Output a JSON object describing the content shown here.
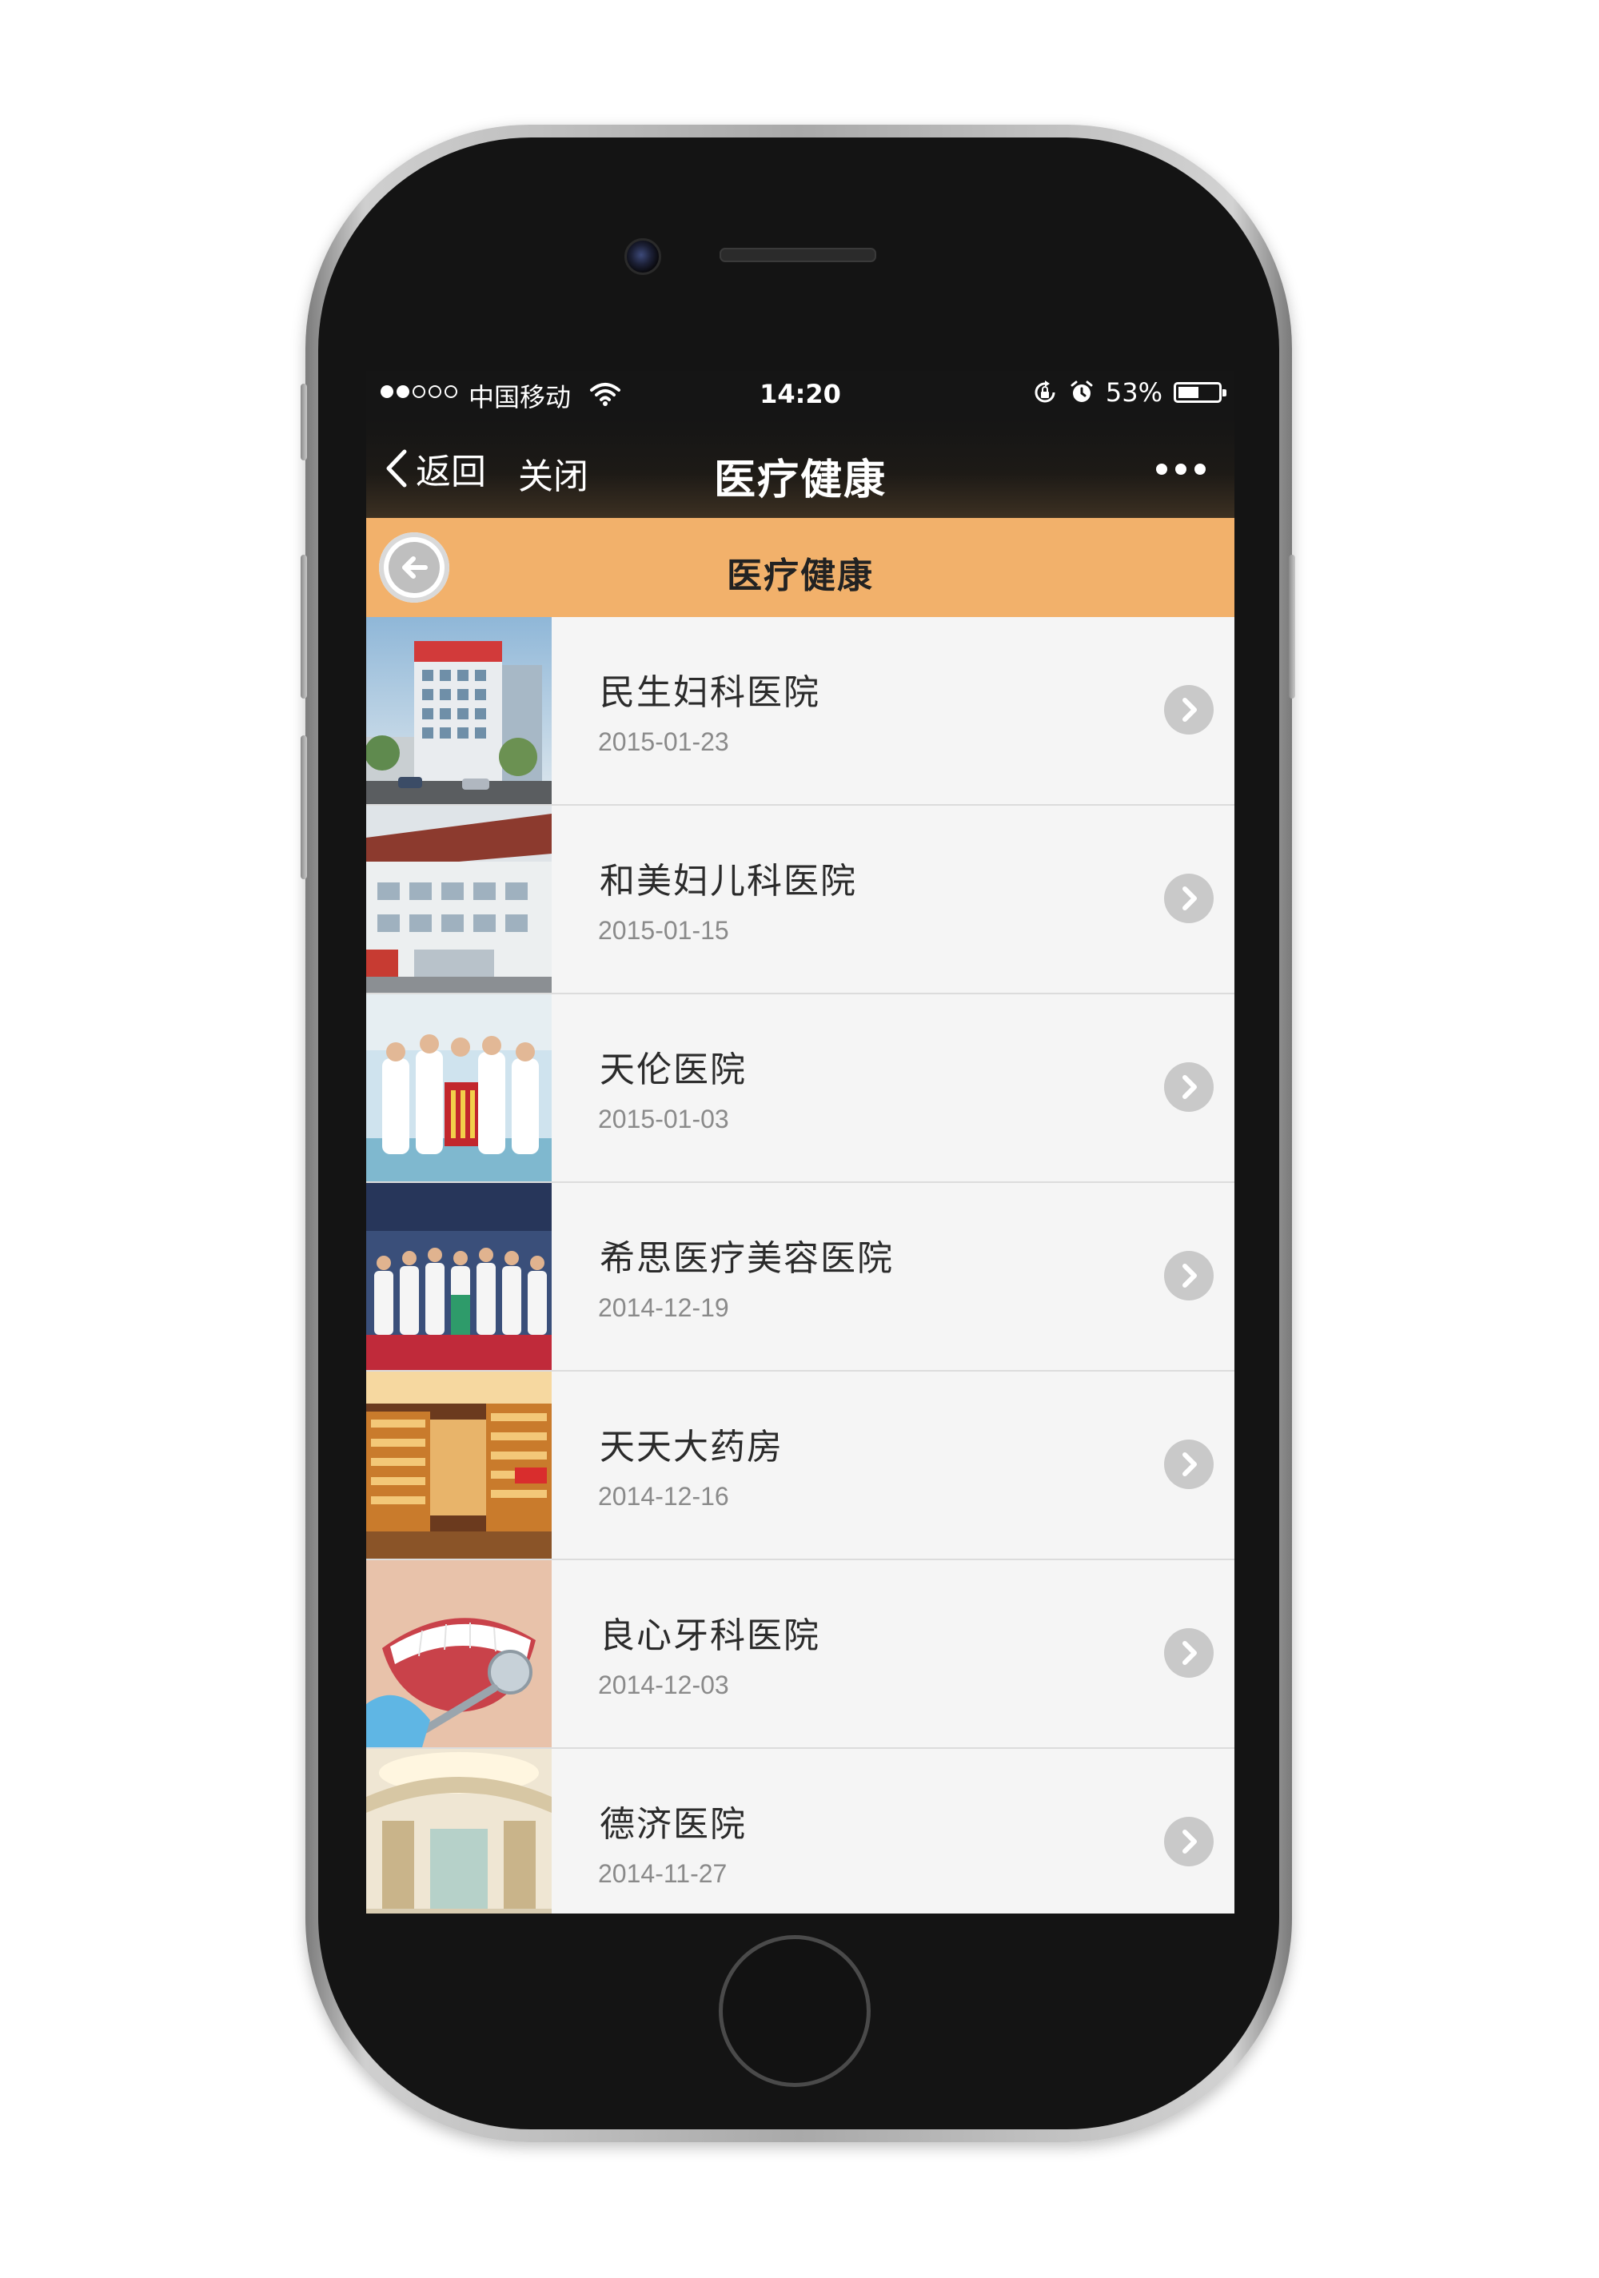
{
  "status_bar": {
    "carrier": "中国移动",
    "time": "14:20",
    "battery_percent": "53%",
    "battery_level": 0.53,
    "signal_strength": 2,
    "signal_max": 5
  },
  "nav_bar": {
    "back_label": "返回",
    "close_label": "关闭",
    "title": "医疗健康",
    "more_icon": "more-dots-icon"
  },
  "page_header": {
    "title": "医疗健康",
    "back_icon": "back-arrow-circle-icon",
    "background_color": "#f2b16b"
  },
  "list": {
    "items": [
      {
        "title": "民生妇科医院",
        "date": "2015-01-23",
        "thumb": "hospital-building-photo"
      },
      {
        "title": "和美妇儿科医院",
        "date": "2015-01-15",
        "thumb": "hospital-exterior-photo"
      },
      {
        "title": "天伦医院",
        "date": "2015-01-03",
        "thumb": "doctors-with-banner-photo"
      },
      {
        "title": "希思医疗美容医院",
        "date": "2014-12-19",
        "thumb": "medical-staff-group-photo"
      },
      {
        "title": "天天大药房",
        "date": "2014-12-16",
        "thumb": "pharmacy-interior-photo"
      },
      {
        "title": "良心牙科医院",
        "date": "2014-12-03",
        "thumb": "dental-smile-photo"
      },
      {
        "title": "德济医院",
        "date": "2014-11-27",
        "thumb": "hospital-lobby-photo"
      }
    ],
    "chevron_icon": "chevron-right-circle-icon"
  },
  "colors": {
    "accent": "#f2b16b",
    "nav_background": "#151515",
    "list_background": "#f5f5f5",
    "divider": "#dcdcdc"
  }
}
